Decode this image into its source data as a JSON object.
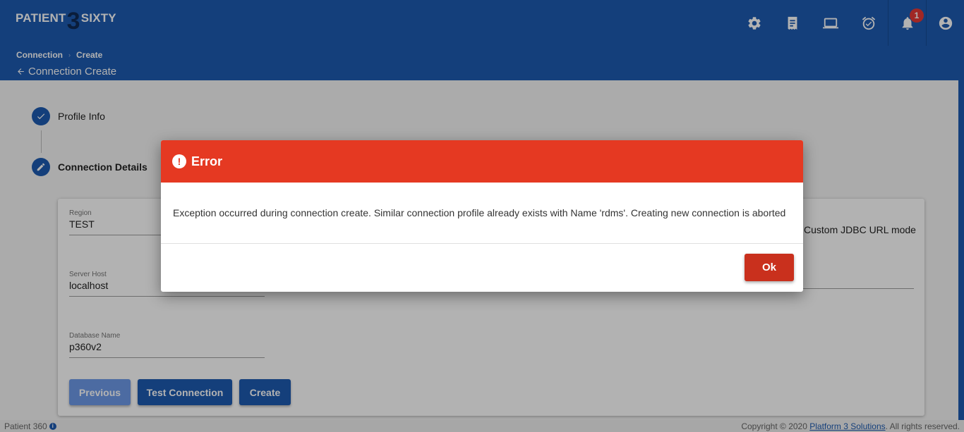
{
  "app": {
    "logo_left": "PATIENT",
    "logo_mid": "3",
    "logo_right": "SIXTY",
    "notification_count": "1"
  },
  "toolbar": {
    "icons": [
      "gear-icon",
      "receipt-icon",
      "laptop-icon",
      "alarm-icon",
      "bell-icon",
      "account-circle-icon"
    ]
  },
  "breadcrumb": {
    "items": [
      "Connection",
      "Create"
    ],
    "separator": "›"
  },
  "page": {
    "title": "Connection Create"
  },
  "stepper": {
    "steps": [
      {
        "label": "Profile Info",
        "state": "complete"
      },
      {
        "label": "Connection Details",
        "state": "active"
      }
    ]
  },
  "form": {
    "region_label": "Region",
    "region_value": "TEST",
    "jdbc_mode_label": "Custom JDBC URL mode",
    "server_host_label": "Server Host",
    "server_host_value": "localhost",
    "database_name_label": "Database Name",
    "database_name_value": "p360v2"
  },
  "buttons": {
    "previous": "Previous",
    "test_connection": "Test Connection",
    "create": "Create"
  },
  "dialog": {
    "title": "Error",
    "icon": "!",
    "message": "Exception occurred during connection create. Similar connection profile already exists with Name 'rdms'. Creating new connection is aborted",
    "ok_label": "Ok"
  },
  "footer": {
    "app_name": "Patient 360",
    "info_icon": "i",
    "copyright_prefix": "Copyright © 2020",
    "company_link": "Platform 3 Solutions",
    "copyright_suffix": ". All rights reserved."
  },
  "colors": {
    "primary": "#1e5bb0",
    "error_header": "#e53922",
    "ok_button": "#c9301d",
    "badge": "#e53935"
  }
}
